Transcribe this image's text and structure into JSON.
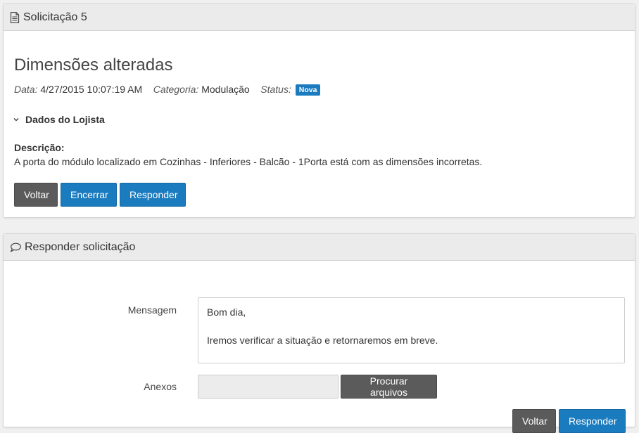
{
  "request_panel": {
    "heading": "Solicitação 5",
    "title": "Dimensões alteradas",
    "meta": {
      "date_label": "Data:",
      "date_value": "4/27/2015 10:07:19 AM",
      "category_label": "Categoria:",
      "category_value": "Modulação",
      "status_label": "Status:",
      "status_value": "Nova",
      "status_color": "#1a7bbf"
    },
    "collapse_label": "Dados do Lojista",
    "description_label": "Descrição:",
    "description_text": "A porta do módulo localizado em Cozinhas - Inferiores - Balcão - 1Porta está com as dimensões incorretas.",
    "buttons": {
      "back": "Voltar",
      "close": "Encerrar",
      "reply": "Responder"
    }
  },
  "reply_panel": {
    "heading": "Responder solicitação",
    "message_label": "Mensagem",
    "message_line1": "Bom dia,",
    "message_line2": "Iremos verificar a situação e retornaremos em breve.",
    "attachments_label": "Anexos",
    "browse_button": "Procurar arquivos",
    "buttons": {
      "back": "Voltar",
      "reply": "Responder"
    }
  },
  "colors": {
    "primary": "#1a7bbf",
    "dark_button": "#5b5b5b"
  }
}
